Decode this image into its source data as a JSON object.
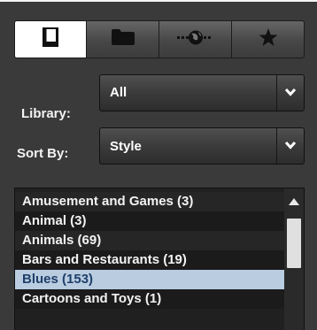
{
  "toolbar": {
    "tabs": [
      {
        "icon": "book-icon",
        "active": true
      },
      {
        "icon": "folder-icon",
        "active": false
      },
      {
        "icon": "globe-network-icon",
        "active": false
      },
      {
        "icon": "star-icon",
        "active": false
      }
    ]
  },
  "library": {
    "label": "Library:",
    "value": "All"
  },
  "sort": {
    "label": "Sort By:",
    "value": "Style"
  },
  "list": {
    "items": [
      {
        "label": "Amusement and Games (3)",
        "selected": false
      },
      {
        "label": "Animal (3)",
        "selected": false
      },
      {
        "label": "Animals (69)",
        "selected": false
      },
      {
        "label": "Bars and Restaurants (19)",
        "selected": false
      },
      {
        "label": "Blues (153)",
        "selected": true
      },
      {
        "label": "Cartoons and Toys (1)",
        "selected": false
      }
    ]
  },
  "colors": {
    "panel_bg": "#3a3a3a",
    "selected_bg": "#b9cce0",
    "selected_text": "#1f3f6a"
  }
}
